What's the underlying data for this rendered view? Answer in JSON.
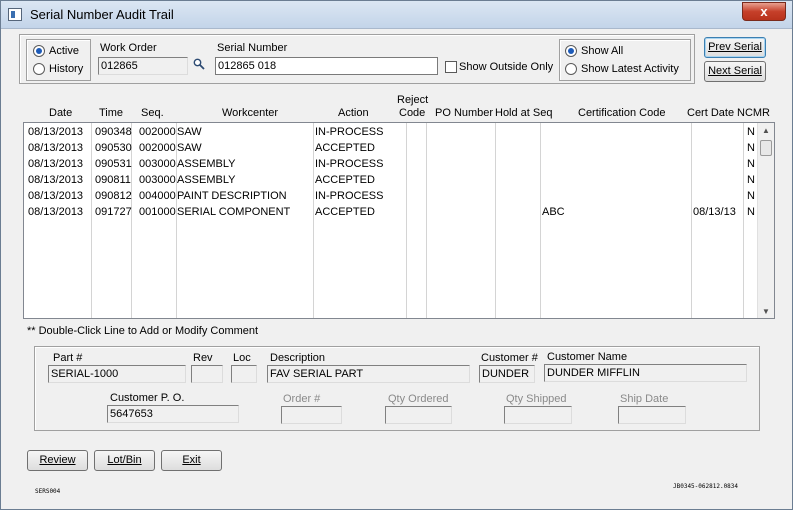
{
  "window": {
    "title": "Serial Number Audit Trail",
    "close_label": "x"
  },
  "filters": {
    "status_active": "Active",
    "status_history": "History",
    "work_order_label": "Work Order",
    "work_order_value": "012865",
    "serial_label": "Serial Number",
    "serial_value": "012865   018",
    "show_outside_only": "Show Outside Only",
    "show_all": "Show All",
    "show_latest": "Show Latest Activity"
  },
  "nav": {
    "prev_serial": "Prev Serial",
    "next_serial": "Next Serial"
  },
  "grid": {
    "columns": {
      "date": "Date",
      "time": "Time",
      "seq": "Seq.",
      "workcenter": "Workcenter",
      "action": "Action",
      "reject_code_1": "Reject",
      "reject_code_2": "Code",
      "po_number": "PO Number",
      "hold_at_seq": "Hold at Seq",
      "certification_code": "Certification Code",
      "cert_date": "Cert Date",
      "ncmr": "NCMR"
    },
    "rows": [
      {
        "date": "08/13/2013",
        "time": "090348",
        "seq": "002000",
        "workcenter": "SAW",
        "action": "IN-PROCESS",
        "cert_code": "",
        "cert_date": "",
        "ncmr": "N"
      },
      {
        "date": "08/13/2013",
        "time": "090530",
        "seq": "002000",
        "workcenter": "SAW",
        "action": "ACCEPTED",
        "cert_code": "",
        "cert_date": "",
        "ncmr": "N"
      },
      {
        "date": "08/13/2013",
        "time": "090531",
        "seq": "003000",
        "workcenter": "ASSEMBLY",
        "action": "IN-PROCESS",
        "cert_code": "",
        "cert_date": "",
        "ncmr": "N"
      },
      {
        "date": "08/13/2013",
        "time": "090811",
        "seq": "003000",
        "workcenter": "ASSEMBLY",
        "action": "ACCEPTED",
        "cert_code": "",
        "cert_date": "",
        "ncmr": "N"
      },
      {
        "date": "08/13/2013",
        "time": "090812",
        "seq": "004000",
        "workcenter": "PAINT DESCRIPTION",
        "action": "IN-PROCESS",
        "cert_code": "",
        "cert_date": "",
        "ncmr": "N"
      },
      {
        "date": "08/13/2013",
        "time": "091727",
        "seq": "001000",
        "workcenter": "SERIAL COMPONENT",
        "action": "ACCEPTED",
        "cert_code": "ABC",
        "cert_date": "08/13/13",
        "ncmr": "N"
      }
    ]
  },
  "hint": "** Double-Click Line to Add or Modify Comment",
  "details": {
    "part_label": "Part #",
    "part_value": "SERIAL-1000",
    "rev_label": "Rev",
    "rev_value": "",
    "loc_label": "Loc",
    "loc_value": "",
    "desc_label": "Description",
    "desc_value": "FAV SERIAL PART",
    "cust_num_label": "Customer #",
    "cust_num_value": "DUNDER",
    "cust_name_label": "Customer Name",
    "cust_name_value": "DUNDER MIFFLIN",
    "cust_po_label": "Customer P. O.",
    "cust_po_value": "5647653",
    "order_label": "Order #",
    "order_value": "",
    "qty_ordered_label": "Qty Ordered",
    "qty_ordered_value": "",
    "qty_shipped_label": "Qty Shipped",
    "qty_shipped_value": "",
    "ship_date_label": "Ship Date",
    "ship_date_value": ""
  },
  "actions": {
    "review": "Review",
    "lot_bin": "Lot/Bin",
    "exit": "Exit"
  },
  "footer": {
    "screen_id": "SERS004",
    "version": "JB0345-062812.0834"
  },
  "icons": {
    "magnifier": "search-icon",
    "app": "app-icon"
  }
}
